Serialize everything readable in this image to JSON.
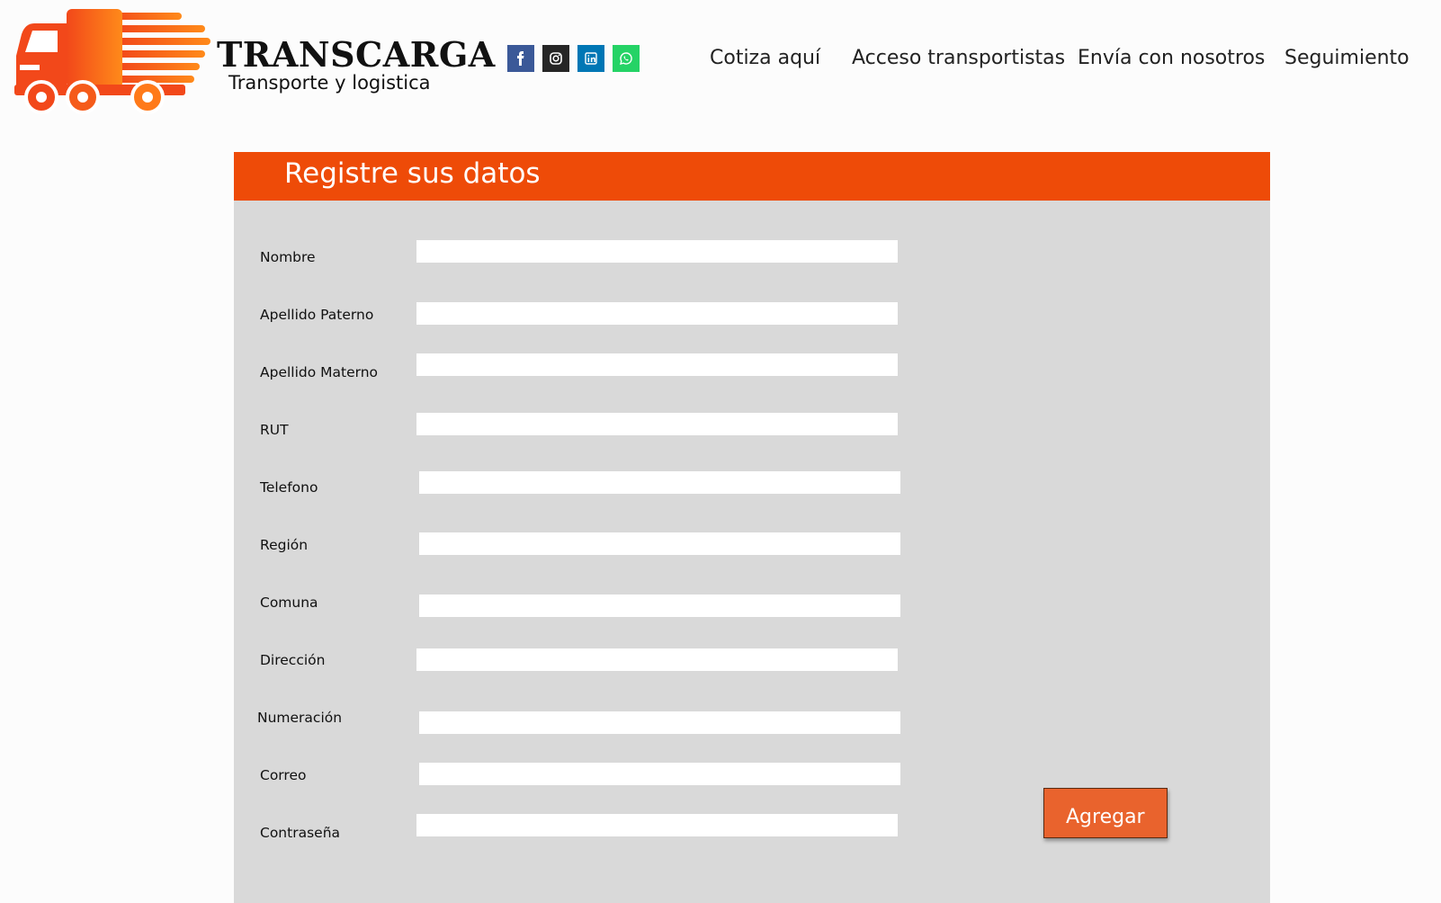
{
  "brand": {
    "name": "TRANSCARGA",
    "tagline": "Transporte y logistica",
    "accent_color": "#ee4b08"
  },
  "social": [
    {
      "icon": "facebook-icon",
      "color": "#3b5998"
    },
    {
      "icon": "instagram-icon",
      "color": "#262626"
    },
    {
      "icon": "linkedin-icon",
      "color": "#0077b5"
    },
    {
      "icon": "whatsapp-icon",
      "color": "#25d366"
    }
  ],
  "nav": {
    "quote": "Cotiza aquí",
    "carriers": "Acceso transportistas",
    "ship": "Envía con nosotros",
    "tracking": "Seguimiento"
  },
  "form": {
    "title": "Registre sus datos",
    "fields": [
      {
        "label": "Nombre",
        "value": ""
      },
      {
        "label": "Apellido Paterno",
        "value": ""
      },
      {
        "label": "Apellido Materno",
        "value": ""
      },
      {
        "label": "RUT",
        "value": ""
      },
      {
        "label": "Telefono",
        "value": ""
      },
      {
        "label": "Región",
        "value": ""
      },
      {
        "label": "Comuna",
        "value": ""
      },
      {
        "label": "Dirección",
        "value": ""
      },
      {
        "label": "Numeración",
        "value": ""
      },
      {
        "label": "Correo",
        "value": ""
      },
      {
        "label": "Contraseña",
        "value": ""
      }
    ],
    "submit_label": "Agregar"
  }
}
